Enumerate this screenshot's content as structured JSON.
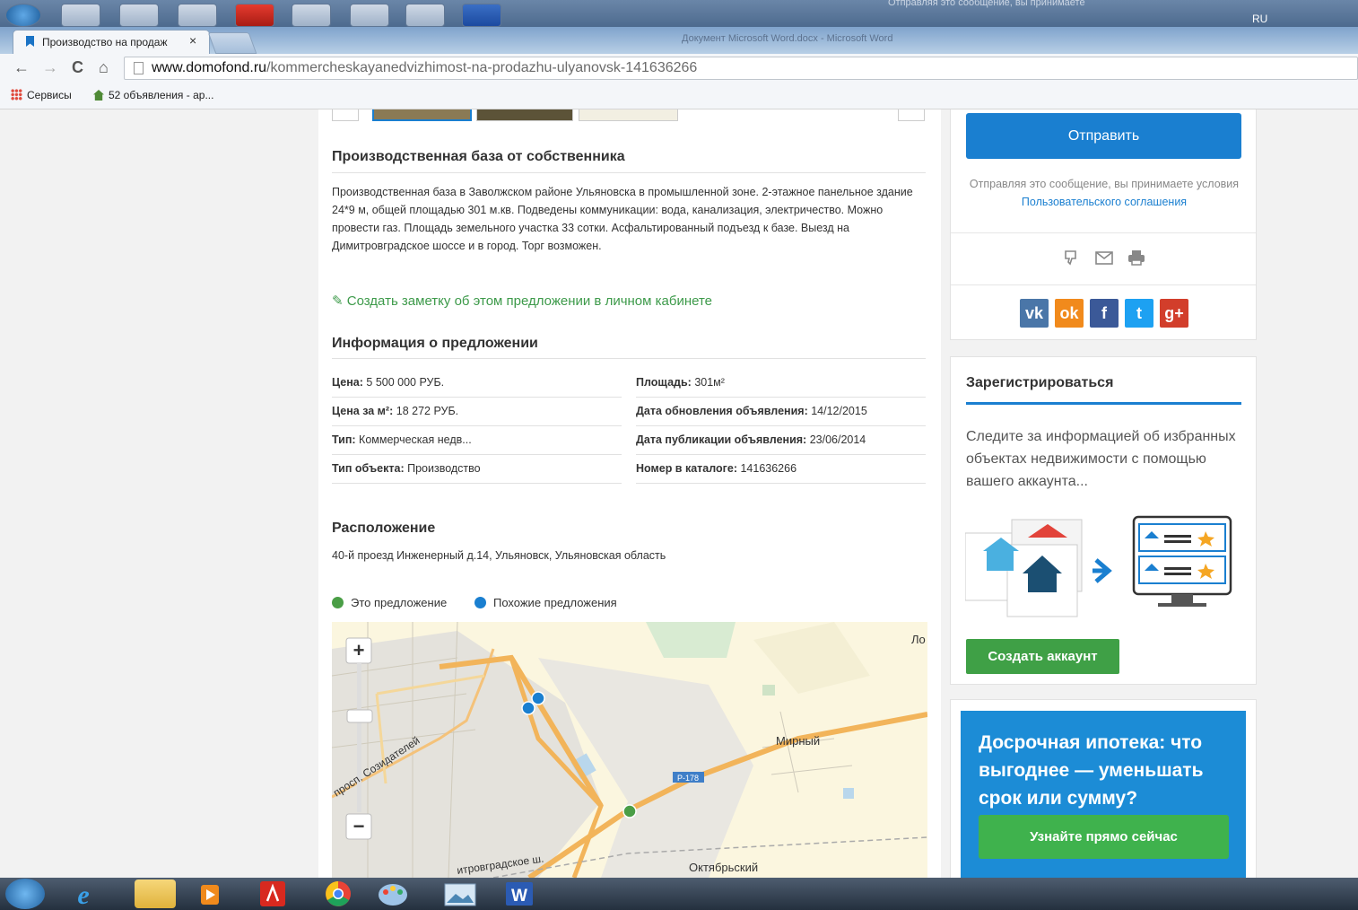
{
  "os": {
    "top_note": "Отправляя это сообщение, вы принимаете",
    "lang": "RU"
  },
  "browser": {
    "tab_title": "Производство на продаж",
    "tab_close": "×",
    "window_title": "Документ Microsoft Word.docx - Microsoft Word",
    "url_domain": "www.domofond.ru",
    "url_path": "/kommercheskayanedvizhimost-na-prodazhu-ulyanovsk-141636266",
    "bookmarks": [
      {
        "label": "Сервисы",
        "icon": "apps-grid-icon"
      },
      {
        "label": "52 объявления - ар...",
        "icon": "house-icon"
      }
    ]
  },
  "listing": {
    "title": "Производственная база от собственника",
    "description": "Производственная база в Заволжском районе Ульяновска в промышленной зоне. 2-этажное панельное здание 24*9 м, общей площадью 301 м.кв. Подведены коммуникации: вода, канализация, электричество. Можно провести газ. Площадь земельного участка 33 сотки. Асфальтированный подъезд к базе. Выезд на Димитровградское шоссе и в город. Торг возможен.",
    "note_link": "Создать заметку об этом предложении в личном кабинете",
    "info_title": "Информация о предложении",
    "info": [
      {
        "label": "Цена:",
        "value": "5 500 000 РУБ."
      },
      {
        "label": "Площадь:",
        "value": "301м²"
      },
      {
        "label": "Цена за м²:",
        "value": "18 272 РУБ."
      },
      {
        "label": "Дата обновления объявления:",
        "value": "14/12/2015"
      },
      {
        "label": "Тип:",
        "value": "Коммерческая недв..."
      },
      {
        "label": "Дата публикации объявления:",
        "value": "23/06/2014"
      },
      {
        "label": "Тип объекта:",
        "value": "Производство"
      },
      {
        "label": "Номер в каталоге:",
        "value": "141636266"
      }
    ],
    "location_title": "Расположение",
    "address": "40-й проезд Инженерный д.14, Ульяновск, Ульяновская область",
    "legend": [
      {
        "label": "Это предложение",
        "color": "#4a9e46"
      },
      {
        "label": "Похожие предложения",
        "color": "#1a7fd0"
      }
    ],
    "map": {
      "labels": [
        "Мирный",
        "Октябрьский",
        "Ло",
        "просп. Созидателей",
        "Р-178",
        "итровградское ш."
      ],
      "zoom_in": "+",
      "zoom_out": "−"
    }
  },
  "sidebar": {
    "send_label": "Отправить",
    "agree_text": "Отправляя это сообщение, вы принимаете условия",
    "agree_link": "Пользовательского соглашения",
    "social": [
      {
        "label": "vk",
        "color": "#4a76a8"
      },
      {
        "label": "ok",
        "color": "#f18a1c"
      },
      {
        "label": "f",
        "color": "#3b5998"
      },
      {
        "label": "t",
        "color": "#1da1f2"
      },
      {
        "label": "g+",
        "color": "#d23e2b"
      }
    ],
    "register_title": "Зарегистрироваться",
    "register_text": "Следите за информацией об избранных объектах недвижимости с помощью вашего аккаунта...",
    "create_label": "Создать аккаунт",
    "promo_title": "Досрочная ипотека: что выгоднее — уменьшать срок или сумму?",
    "promo_button": "Узнайте прямо сейчас"
  },
  "colors": {
    "accent": "#1a7fd0",
    "green": "#3fa046"
  }
}
